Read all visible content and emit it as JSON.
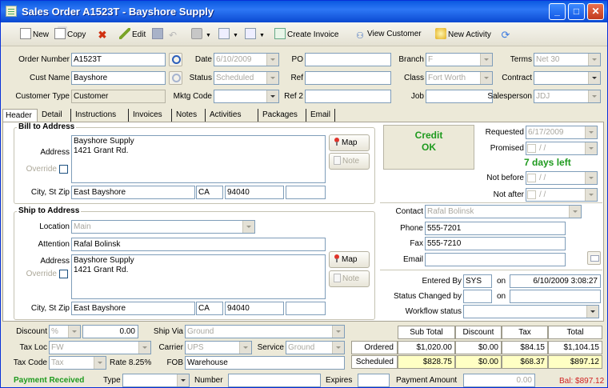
{
  "window": {
    "title": "Sales Order A1523T - Bayshore Supply"
  },
  "toolbar": {
    "new": "New",
    "copy": "Copy",
    "edit": "Edit",
    "create_invoice": "Create Invoice",
    "view_customer": "View Customer",
    "new_activity": "New Activity"
  },
  "header": {
    "order_number_label": "Order Number",
    "order_number": "A1523T",
    "date_label": "Date",
    "date": "6/10/2009",
    "po_label": "PO",
    "po": "",
    "branch_label": "Branch",
    "branch": "F",
    "terms_label": "Terms",
    "terms": "Net 30",
    "cust_name_label": "Cust Name",
    "cust_name": "Bayshore",
    "status_label": "Status",
    "status": "Scheduled",
    "ref_label": "Ref",
    "ref": "",
    "class_label": "Class",
    "class": "Fort Worth",
    "contract_label": "Contract",
    "contract": "",
    "customer_type_label": "Customer Type",
    "customer_type": "Customer",
    "mktg_code_label": "Mktg Code",
    "mktg_code": "",
    "ref2_label": "Ref 2",
    "ref2": "",
    "job_label": "Job",
    "job": "",
    "salesperson_label": "Salesperson",
    "salesperson": "JDJ"
  },
  "tabs": [
    "Header",
    "Detail",
    "Instructions",
    "Invoices",
    "Notes",
    "Activities",
    "Packages",
    "Email"
  ],
  "bill_to": {
    "title": "Bill to Address",
    "address_label": "Address",
    "address": "Bayshore Supply\n1421 Grant Rd.",
    "override_label": "Override",
    "city_label": "City, St Zip",
    "city": "East Bayshore",
    "state": "CA",
    "zip": "94040",
    "map": "Map",
    "note": "Note"
  },
  "ship_to": {
    "title": "Ship to Address",
    "location_label": "Location",
    "location": "Main",
    "attention_label": "Attention",
    "attention": "Rafal Bolinsk",
    "address_label": "Address",
    "address": "Bayshore Supply\n1421 Grant Rd.",
    "override_label": "Override",
    "city_label": "City, St Zip",
    "city": "East Bayshore",
    "state": "CA",
    "zip": "94040",
    "map": "Map",
    "note": "Note"
  },
  "credit": {
    "line1": "Credit",
    "line2": "OK"
  },
  "dates": {
    "requested_label": "Requested",
    "requested": "6/17/2009",
    "promised_label": "Promised",
    "promised": "/ /",
    "days_left": "7 days left",
    "not_before_label": "Not before",
    "not_before": "/ /",
    "not_after_label": "Not after",
    "not_after": "/ /"
  },
  "contact": {
    "contact_label": "Contact",
    "contact": "Rafal Bolinsk",
    "phone_label": "Phone",
    "phone": "555-7201",
    "fax_label": "Fax",
    "fax": "555-7210",
    "email_label": "Email",
    "email": ""
  },
  "audit": {
    "entered_by_label": "Entered By",
    "entered_by": "SYS",
    "on_label": "on",
    "entered_on": "6/10/2009 3:08:27",
    "status_changed_label": "Status Changed by",
    "status_changed_by": "",
    "status_changed_on": "",
    "workflow_label": "Workflow status",
    "workflow": ""
  },
  "footer": {
    "discount_label": "Discount",
    "discount_type": "%",
    "discount_value": "0.00",
    "ship_via_label": "Ship Via",
    "ship_via": "Ground",
    "tax_loc_label": "Tax Loc",
    "tax_loc": "FW",
    "carrier_label": "Carrier",
    "carrier": "UPS",
    "service_label": "Service",
    "service": "Ground",
    "tax_code_label": "Tax Code",
    "tax_code": "Tax",
    "rate": "Rate 8.25%",
    "fob_label": "FOB",
    "fob": "Warehouse",
    "payment_received": "Payment Received",
    "type_label": "Type",
    "type": "",
    "number_label": "Number",
    "number": "",
    "expires_label": "Expires",
    "expires": "",
    "payment_amount_label": "Payment Amount",
    "payment_amount": "0.00",
    "balance": "Bal: $897.12"
  },
  "totals": {
    "headers": [
      "Sub Total",
      "Discount",
      "Tax",
      "Total"
    ],
    "rows": [
      {
        "label": "Ordered",
        "values": [
          "$1,020.00",
          "$0.00",
          "$84.15",
          "$1,104.15"
        ]
      },
      {
        "label": "Scheduled",
        "values": [
          "$828.75",
          "$0.00",
          "$68.37",
          "$897.12"
        ]
      }
    ]
  }
}
